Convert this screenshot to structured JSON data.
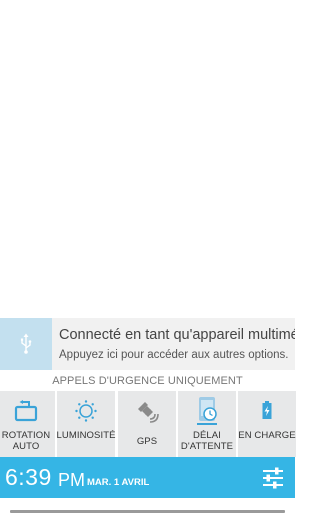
{
  "usb_notification": {
    "title": "Connecté en tant qu'appareil multimédia",
    "subtitle": "Appuyez ici pour accéder aux autres options."
  },
  "emergency_text": "APPELS D'URGENCE UNIQUEMENT",
  "quick_settings": [
    {
      "label": "ROTATION AUTO",
      "icon": "rotation-icon"
    },
    {
      "label": "LUMINOSITÉ",
      "icon": "brightness-icon"
    },
    {
      "label": "GPS",
      "icon": "gps-icon"
    },
    {
      "label": "DÉLAI D'ATTENTE",
      "icon": "timeout-icon"
    },
    {
      "label": "EN CHARGE",
      "icon": "battery-icon"
    }
  ],
  "status": {
    "time": "6:39",
    "ampm": "PM",
    "date": "MAR. 1 AVRIL"
  },
  "colors": {
    "accent": "#35b5e5",
    "icon_blue": "#3aa3d8"
  }
}
